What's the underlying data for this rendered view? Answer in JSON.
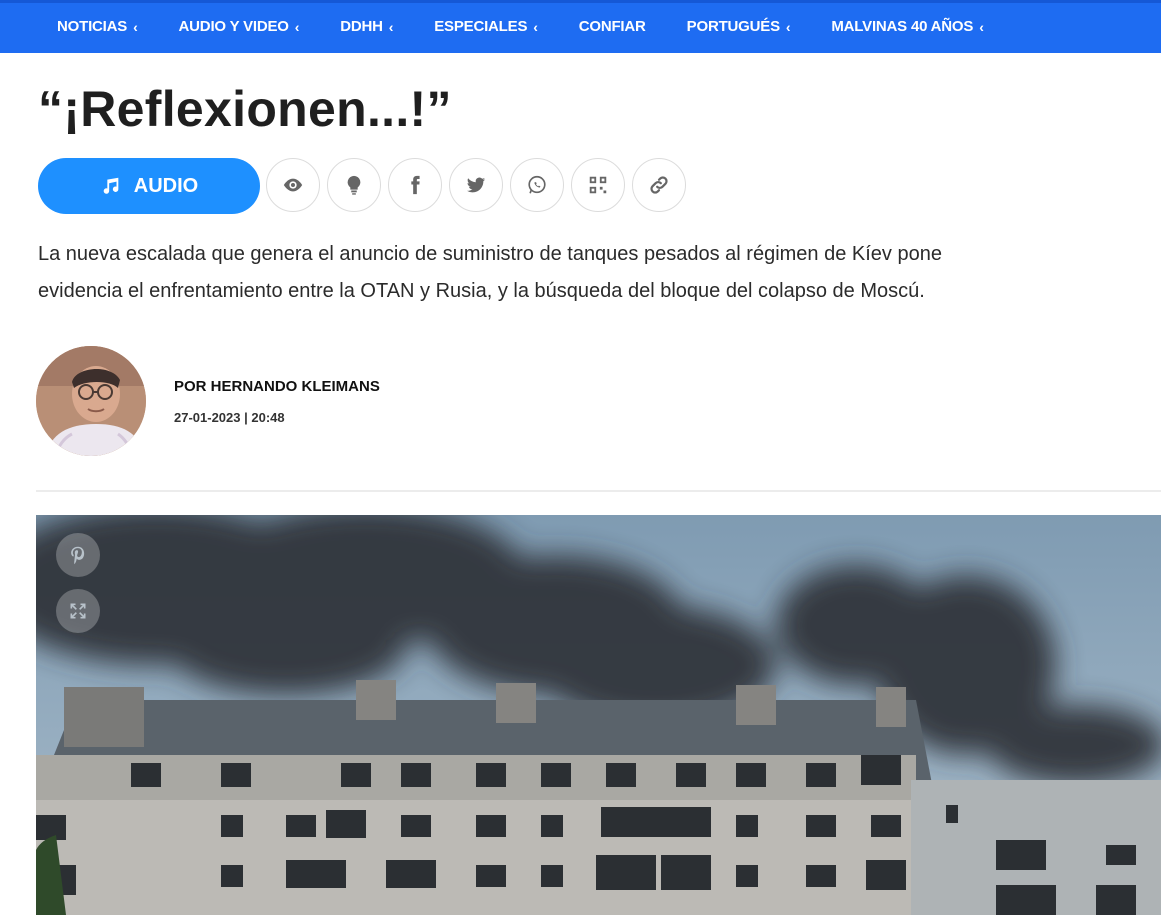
{
  "nav": {
    "items": [
      {
        "label": "NOTICIAS",
        "chevron": "‹"
      },
      {
        "label": "AUDIO Y VIDEO",
        "chevron": "‹"
      },
      {
        "label": "DDHH",
        "chevron": "‹"
      },
      {
        "label": "ESPECIALES",
        "chevron": "‹"
      },
      {
        "label": "CONFIAR",
        "chevron": ""
      },
      {
        "label": "PORTUGUÉS",
        "chevron": "‹"
      },
      {
        "label": "MALVINAS 40 AÑOS",
        "chevron": "‹"
      }
    ]
  },
  "article": {
    "title": "“¡Reflexionen...!”",
    "lead_line1": "La nueva escalada que genera el anuncio de suministro de tanques pesados al régimen de Kíev pone",
    "lead_line2": "evidencia el enfrentamiento entre la OTAN y Rusia, y la búsqueda del bloque del colapso de Moscú.",
    "author": "POR HERNANDO KLEIMANS",
    "datetime": "27-01-2023 | 20:48"
  },
  "share": {
    "audio_label": "AUDIO",
    "icons": [
      "eye-icon",
      "lightbulb-icon",
      "facebook-icon",
      "twitter-icon",
      "whatsapp-icon",
      "qr-code-icon",
      "link-icon"
    ]
  },
  "colors": {
    "nav_bg": "#1e6cf2",
    "audio_button": "#1e90ff"
  }
}
